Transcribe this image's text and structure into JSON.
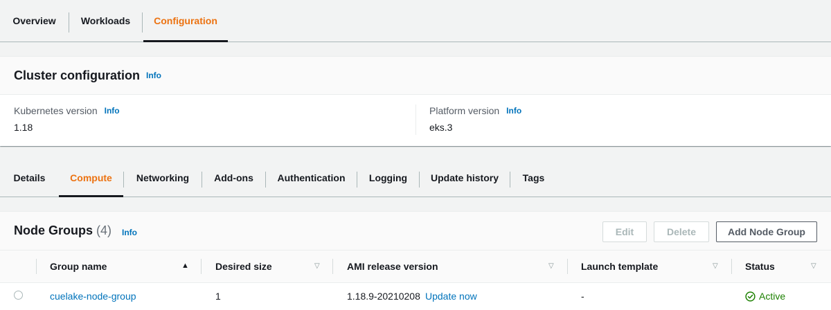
{
  "top_tabs": [
    {
      "label": "Overview",
      "active": false
    },
    {
      "label": "Workloads",
      "active": false
    },
    {
      "label": "Configuration",
      "active": true
    }
  ],
  "cluster_config": {
    "title": "Cluster configuration",
    "info": "Info",
    "kubernetes": {
      "label": "Kubernetes version",
      "info": "Info",
      "value": "1.18"
    },
    "platform": {
      "label": "Platform version",
      "info": "Info",
      "value": "eks.3"
    }
  },
  "sub_tabs": [
    {
      "label": "Details",
      "active": false
    },
    {
      "label": "Compute",
      "active": true
    },
    {
      "label": "Networking",
      "active": false
    },
    {
      "label": "Add-ons",
      "active": false
    },
    {
      "label": "Authentication",
      "active": false
    },
    {
      "label": "Logging",
      "active": false
    },
    {
      "label": "Update history",
      "active": false
    },
    {
      "label": "Tags",
      "active": false
    }
  ],
  "node_groups": {
    "title": "Node Groups",
    "count": "(4)",
    "info": "Info",
    "buttons": {
      "edit": "Edit",
      "delete": "Delete",
      "add": "Add Node Group"
    },
    "columns": [
      "Group name",
      "Desired size",
      "AMI release version",
      "Launch template",
      "Status"
    ],
    "rows": [
      {
        "group_name": "cuelake-node-group",
        "desired_size": "1",
        "ami_release": "1.18.9-20210208",
        "update_link": "Update now",
        "launch_template": "-",
        "status": "Active"
      }
    ]
  },
  "colors": {
    "accent": "#ec7211",
    "link": "#0073bb",
    "success": "#1d8102"
  }
}
